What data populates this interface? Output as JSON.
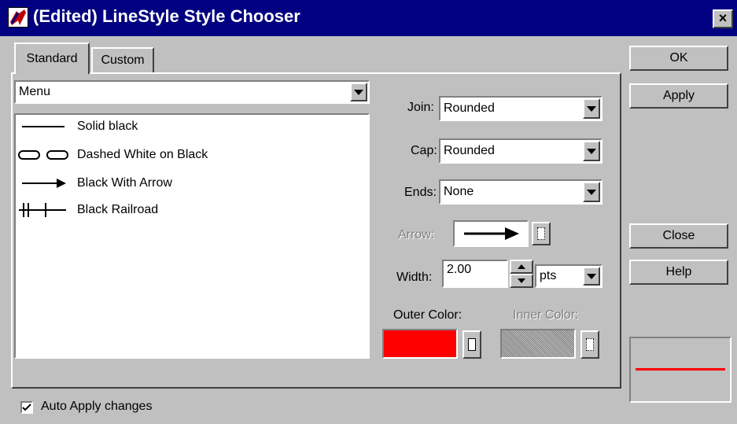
{
  "window": {
    "title": "(Edited) LineStyle Style Chooser",
    "close_label": "×"
  },
  "tabs": [
    {
      "label": "Standard",
      "active": true
    },
    {
      "label": "Custom",
      "active": false
    }
  ],
  "buttons": {
    "ok": "OK",
    "apply": "Apply",
    "close": "Close",
    "help": "Help"
  },
  "menu_select": {
    "value": "Menu"
  },
  "styles_list": [
    {
      "label": "Solid black",
      "icon": "solid-line-icon"
    },
    {
      "label": "Dashed White on Black",
      "icon": "dashed-line-icon"
    },
    {
      "label": "Black With Arrow",
      "icon": "arrow-line-icon"
    },
    {
      "label": "Black Railroad",
      "icon": "railroad-line-icon"
    }
  ],
  "join": {
    "label": "Join:",
    "value": "Rounded"
  },
  "cap": {
    "label": "Cap:",
    "value": "Rounded"
  },
  "ends": {
    "label": "Ends:",
    "value": "None"
  },
  "arrow": {
    "label": "Arrow:"
  },
  "width": {
    "label": "Width:",
    "value": "2.00",
    "unit": "pts"
  },
  "outer_color": {
    "label": "Outer Color:",
    "color": "#ff0000"
  },
  "inner_color": {
    "label": "Inner Color:"
  },
  "preview": {
    "line_color": "#ff0000"
  },
  "auto_apply": {
    "label": "Auto Apply changes",
    "checked": true
  },
  "colors": {
    "titlebar": "#000080",
    "face": "#c0c0c0"
  }
}
